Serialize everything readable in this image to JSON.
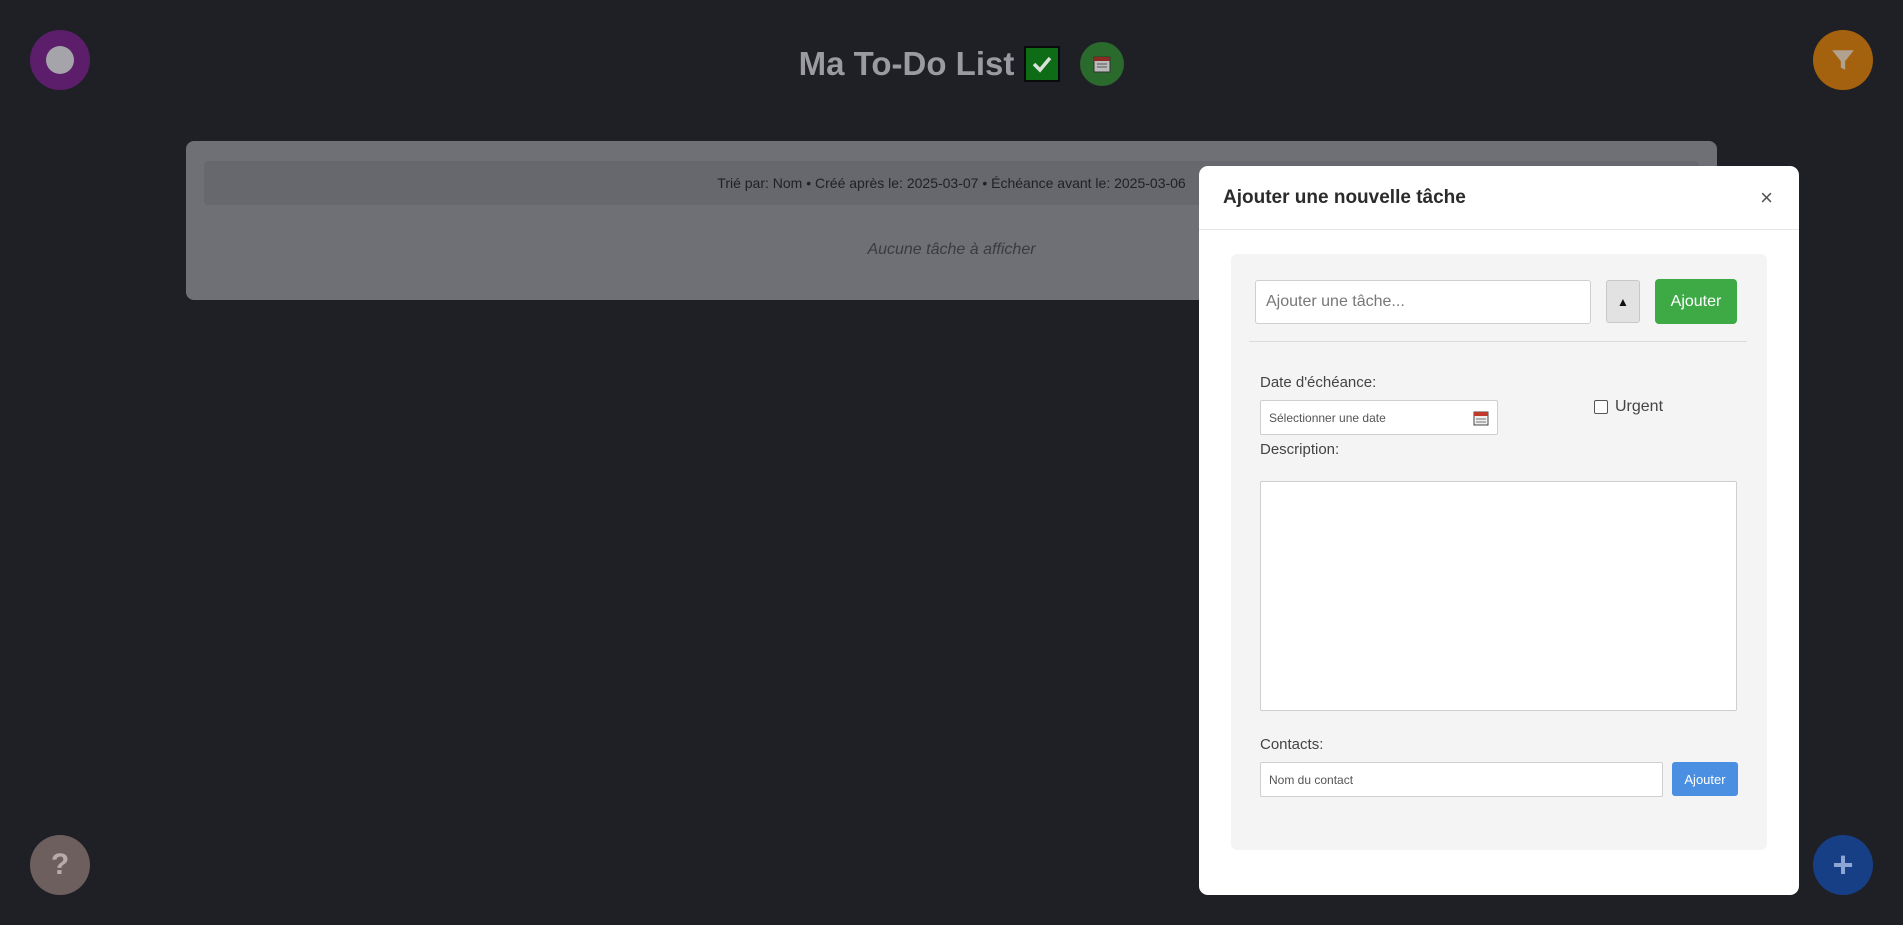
{
  "app": {
    "title": "Ma To-Do List",
    "filter_summary": "Trié par: Nom • Créé après le: 2025-03-07 • Échéance avant le: 2025-03-06",
    "empty_message": "Aucune tâche à afficher",
    "help_label": "?",
    "add_label": "+"
  },
  "modal": {
    "title": "Ajouter une nouvelle tâche",
    "close_label": "×",
    "task_placeholder": "Ajouter une tâche...",
    "toggle_label": "▲",
    "add_task_label": "Ajouter",
    "due_date_label": "Date d'échéance:",
    "date_placeholder": "Sélectionner une date",
    "urgent_label": "Urgent",
    "description_label": "Description:",
    "contacts_label": "Contacts:",
    "contact_placeholder": "Nom du contact",
    "add_contact_label": "Ajouter"
  },
  "colors": {
    "background": "#1f2026",
    "add_task_button": "#3daa46",
    "add_contact_button": "#4a8fe1",
    "theme_button": "#5c1d6b",
    "filter_button": "#a4620e"
  }
}
